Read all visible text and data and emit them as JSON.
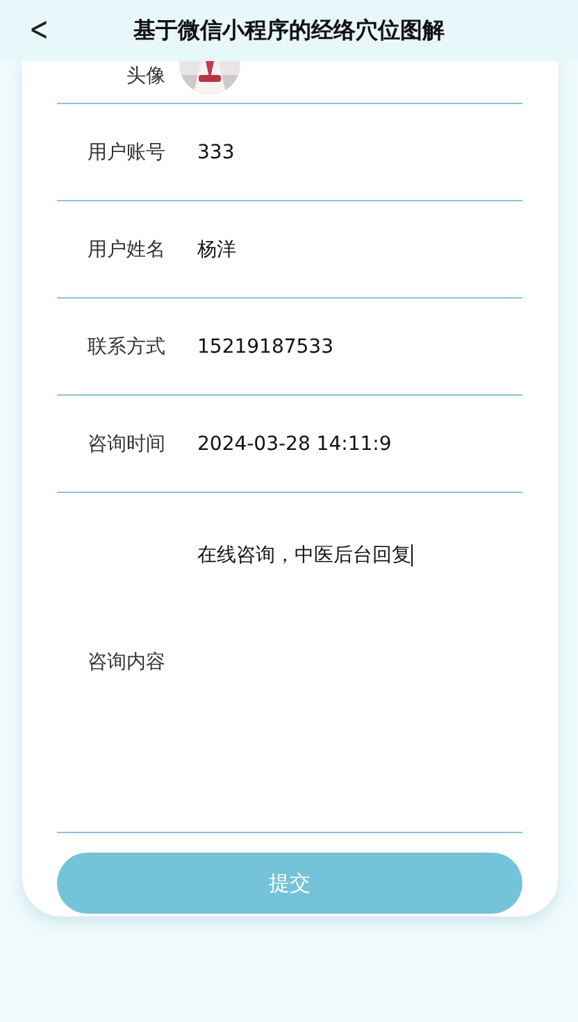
{
  "header": {
    "back_icon": "<",
    "title": "基于微信小程序的经络穴位图解"
  },
  "avatar_row": {
    "label": "头像"
  },
  "fields": [
    {
      "kind": "input",
      "label": "用户账号",
      "value": "333"
    },
    {
      "kind": "input",
      "label": "用户姓名",
      "value": "杨洋"
    },
    {
      "kind": "input",
      "label": "联系方式",
      "value": "15219187533"
    },
    {
      "kind": "input",
      "label": "咨询时间",
      "value": "2024-03-28 14:11:9"
    },
    {
      "kind": "textarea",
      "label": "咨询内容",
      "value": "在线咨询，中医后台回复",
      "focused": true
    }
  ],
  "submit_button": "提交"
}
